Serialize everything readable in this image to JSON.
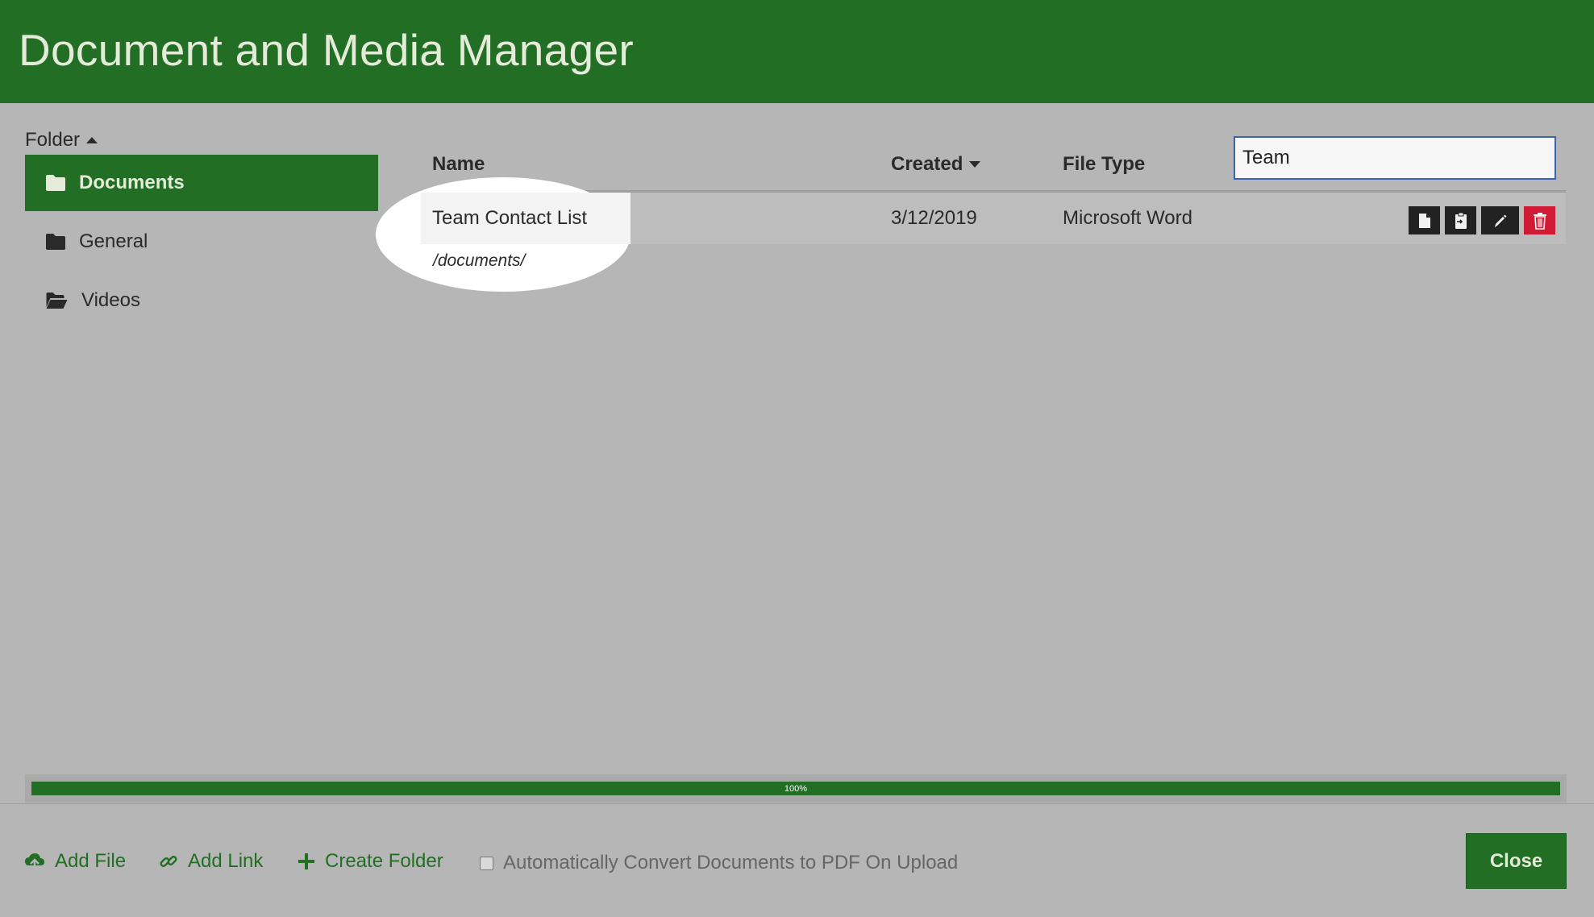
{
  "header": {
    "title": "Document and Media Manager"
  },
  "sidebar": {
    "heading": "Folder",
    "items": [
      {
        "label": "Documents",
        "icon": "folder-icon",
        "active": true
      },
      {
        "label": "General",
        "icon": "folder-icon",
        "active": false
      },
      {
        "label": "Videos",
        "icon": "folder-open-icon",
        "active": false
      }
    ]
  },
  "table": {
    "columns": {
      "name": "Name",
      "created": "Created",
      "file_type": "File Type"
    },
    "search": {
      "value": "Team",
      "placeholder": ""
    },
    "rows": [
      {
        "name": "Team Contact List",
        "path": "/documents/",
        "created": "3/12/2019",
        "file_type": "Microsoft Word",
        "actions": [
          "file-icon",
          "clipboard-icon",
          "pencil-icon",
          "trash-icon"
        ]
      }
    ]
  },
  "progress": {
    "value": 1.0,
    "label": "100%"
  },
  "footer": {
    "add_file": "Add File",
    "add_link": "Add Link",
    "create_folder": "Create Folder",
    "convert_label": "Automatically Convert Documents to PDF On Upload",
    "convert_checked": false,
    "close": "Close"
  },
  "colors": {
    "brand_green": "#216e24",
    "danger": "#d11a36",
    "focus_border": "#3a62b8"
  }
}
